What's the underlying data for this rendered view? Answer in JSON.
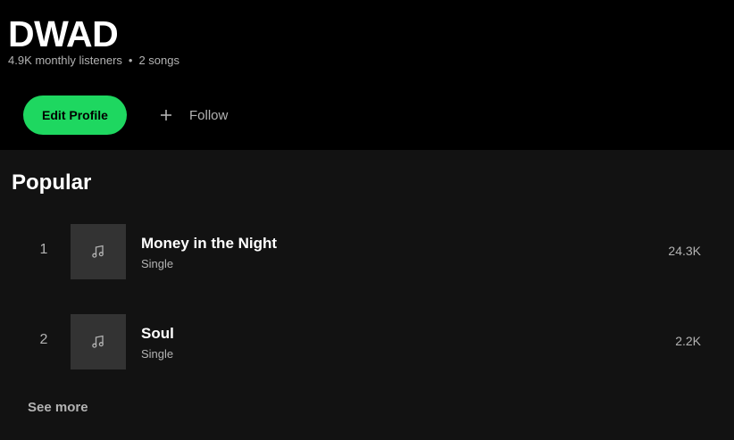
{
  "artist": {
    "name": "DWAD",
    "monthly_listeners": "4.9K monthly listeners",
    "separator": "•",
    "songs_count": "2 songs"
  },
  "actions": {
    "edit_profile_label": "Edit Profile",
    "follow_label": "Follow",
    "accent_color": "#1ed760"
  },
  "popular": {
    "title": "Popular",
    "tracks": [
      {
        "number": "1",
        "title": "Money in the Night",
        "type": "Single",
        "plays": "24.3K",
        "icon": "music-note-icon"
      },
      {
        "number": "2",
        "title": "Soul",
        "type": "Single",
        "plays": "2.2K",
        "icon": "music-note-icon"
      }
    ],
    "see_more_label": "See more"
  }
}
